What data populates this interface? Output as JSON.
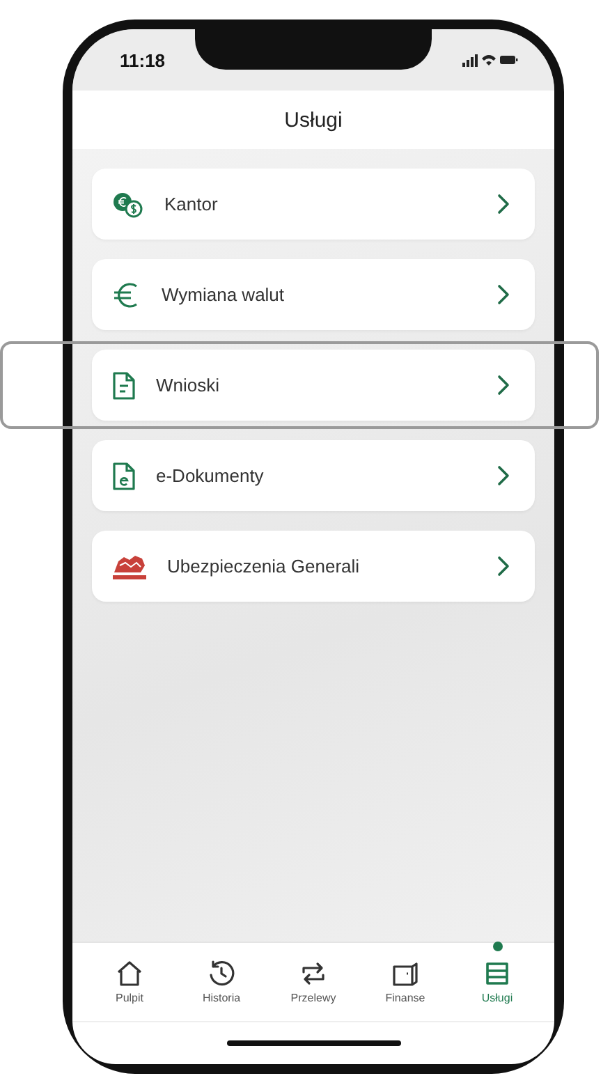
{
  "status_bar": {
    "time": "11:18"
  },
  "header": {
    "title": "Usługi"
  },
  "services": [
    {
      "kind": "coins",
      "label": "Kantor",
      "highlighted": false
    },
    {
      "kind": "euro",
      "label": "Wymiana walut",
      "highlighted": false
    },
    {
      "kind": "document",
      "label": "Wnioski",
      "highlighted": true
    },
    {
      "kind": "edocument",
      "label": "e-Dokumenty",
      "highlighted": false
    },
    {
      "kind": "lion",
      "label": "Ubezpieczenia Generali",
      "highlighted": false
    }
  ],
  "tab_bar": [
    {
      "kind": "home",
      "label": "Pulpit",
      "selected": false
    },
    {
      "kind": "history",
      "label": "Historia",
      "selected": false
    },
    {
      "kind": "transfer",
      "label": "Przelewy",
      "selected": false
    },
    {
      "kind": "wallet",
      "label": "Finanse",
      "selected": false
    },
    {
      "kind": "database",
      "label": "Usługi",
      "selected": true
    }
  ]
}
